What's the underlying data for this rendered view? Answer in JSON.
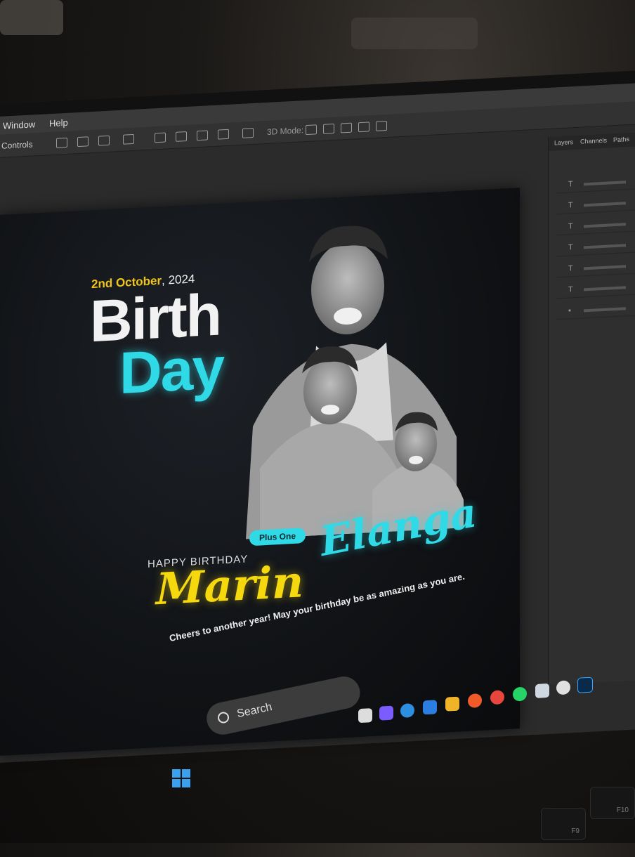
{
  "menubar": {
    "items": [
      "Window",
      "Help"
    ]
  },
  "optionsbar": {
    "label": "Controls",
    "mode_label": "3D Mode:"
  },
  "panel": {
    "tabs": [
      "Layers",
      "Channels",
      "Paths"
    ]
  },
  "poster": {
    "date_day": "2nd October",
    "date_year": ", 2024",
    "title_line1": "Birth",
    "title_line2": "Day",
    "happy": "HAPPY BIRTHDAY",
    "badge": "Plus One",
    "first_name": "Marin",
    "last_name": "Elanga",
    "wish": "Cheers to another year! May your birthday be as amazing as you are."
  },
  "taskbar": {
    "search_placeholder": "Search"
  },
  "keyboard": {
    "keys": [
      "F9",
      "F10"
    ]
  }
}
